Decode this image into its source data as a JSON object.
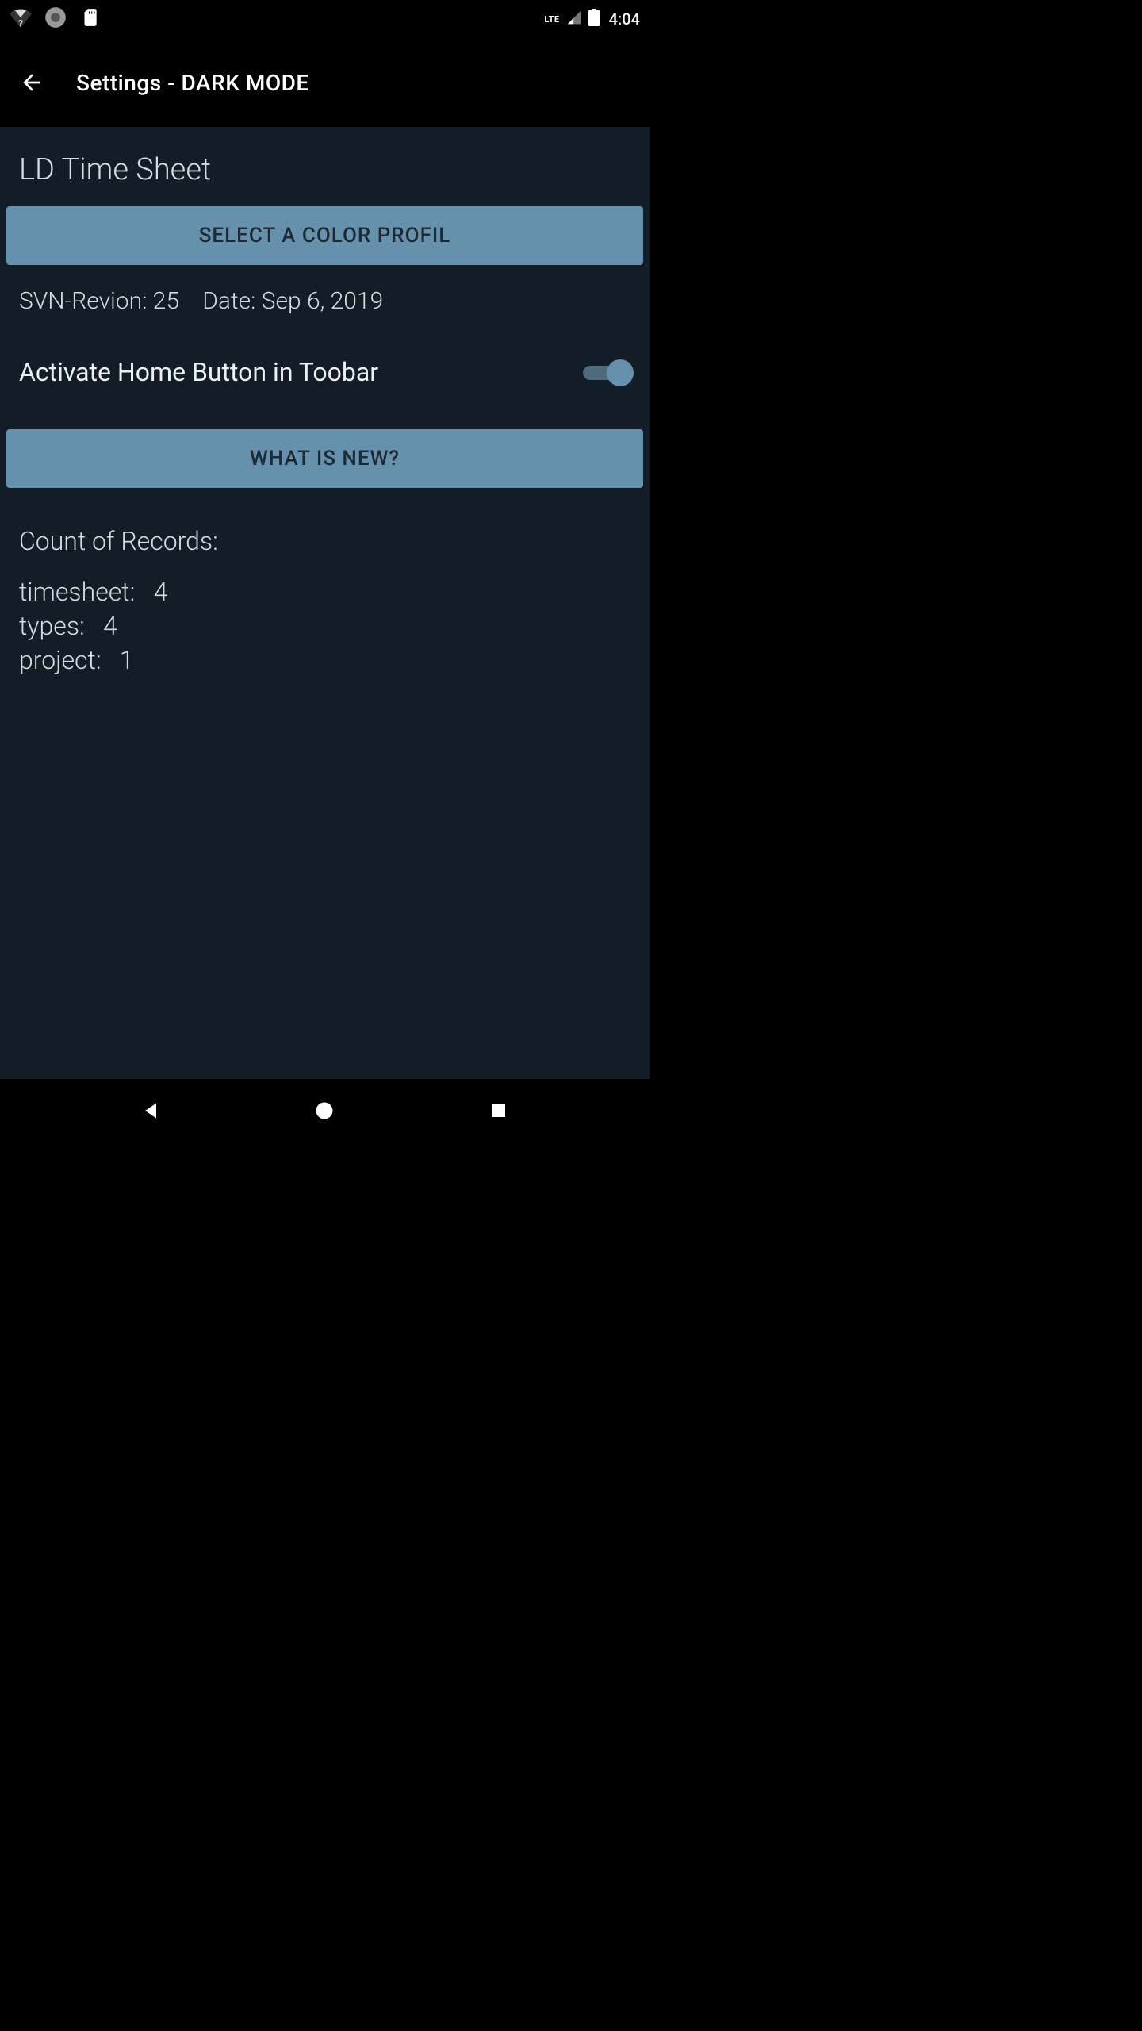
{
  "status_bar": {
    "lte_label": "LTE",
    "time": "4:04"
  },
  "app_bar": {
    "title": "Settings  -  DARK MODE"
  },
  "section_title": "LD Time Sheet",
  "select_color_btn": "SELECT A COLOR PROFIL",
  "info_line": "SVN-Revion: 25    Date: Sep 6, 2019",
  "toggle_home": {
    "label": "Activate Home Button in Toobar",
    "enabled": true
  },
  "whats_new_btn": "WHAT IS NEW?",
  "records": {
    "heading": "Count of Records:",
    "items": "timesheet:   4\ntypes:   4\nproject:   1"
  }
}
